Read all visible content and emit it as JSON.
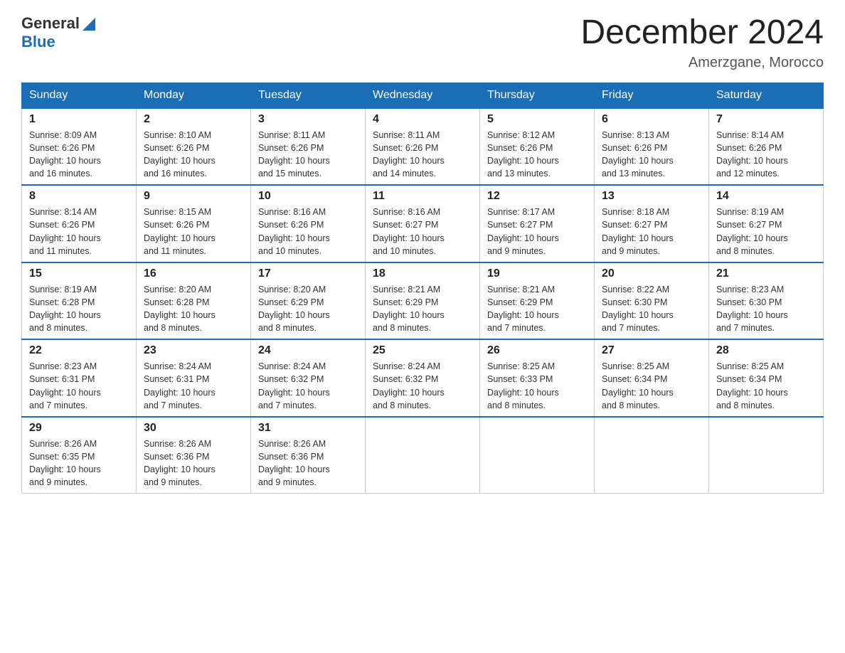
{
  "header": {
    "logo_general": "General",
    "logo_blue": "Blue",
    "month_title": "December 2024",
    "location": "Amerzgane, Morocco"
  },
  "weekdays": [
    "Sunday",
    "Monday",
    "Tuesday",
    "Wednesday",
    "Thursday",
    "Friday",
    "Saturday"
  ],
  "weeks": [
    [
      {
        "day": "1",
        "sunrise": "8:09 AM",
        "sunset": "6:26 PM",
        "daylight": "10 hours and 16 minutes."
      },
      {
        "day": "2",
        "sunrise": "8:10 AM",
        "sunset": "6:26 PM",
        "daylight": "10 hours and 16 minutes."
      },
      {
        "day": "3",
        "sunrise": "8:11 AM",
        "sunset": "6:26 PM",
        "daylight": "10 hours and 15 minutes."
      },
      {
        "day": "4",
        "sunrise": "8:11 AM",
        "sunset": "6:26 PM",
        "daylight": "10 hours and 14 minutes."
      },
      {
        "day": "5",
        "sunrise": "8:12 AM",
        "sunset": "6:26 PM",
        "daylight": "10 hours and 13 minutes."
      },
      {
        "day": "6",
        "sunrise": "8:13 AM",
        "sunset": "6:26 PM",
        "daylight": "10 hours and 13 minutes."
      },
      {
        "day": "7",
        "sunrise": "8:14 AM",
        "sunset": "6:26 PM",
        "daylight": "10 hours and 12 minutes."
      }
    ],
    [
      {
        "day": "8",
        "sunrise": "8:14 AM",
        "sunset": "6:26 PM",
        "daylight": "10 hours and 11 minutes."
      },
      {
        "day": "9",
        "sunrise": "8:15 AM",
        "sunset": "6:26 PM",
        "daylight": "10 hours and 11 minutes."
      },
      {
        "day": "10",
        "sunrise": "8:16 AM",
        "sunset": "6:26 PM",
        "daylight": "10 hours and 10 minutes."
      },
      {
        "day": "11",
        "sunrise": "8:16 AM",
        "sunset": "6:27 PM",
        "daylight": "10 hours and 10 minutes."
      },
      {
        "day": "12",
        "sunrise": "8:17 AM",
        "sunset": "6:27 PM",
        "daylight": "10 hours and 9 minutes."
      },
      {
        "day": "13",
        "sunrise": "8:18 AM",
        "sunset": "6:27 PM",
        "daylight": "10 hours and 9 minutes."
      },
      {
        "day": "14",
        "sunrise": "8:19 AM",
        "sunset": "6:27 PM",
        "daylight": "10 hours and 8 minutes."
      }
    ],
    [
      {
        "day": "15",
        "sunrise": "8:19 AM",
        "sunset": "6:28 PM",
        "daylight": "10 hours and 8 minutes."
      },
      {
        "day": "16",
        "sunrise": "8:20 AM",
        "sunset": "6:28 PM",
        "daylight": "10 hours and 8 minutes."
      },
      {
        "day": "17",
        "sunrise": "8:20 AM",
        "sunset": "6:29 PM",
        "daylight": "10 hours and 8 minutes."
      },
      {
        "day": "18",
        "sunrise": "8:21 AM",
        "sunset": "6:29 PM",
        "daylight": "10 hours and 8 minutes."
      },
      {
        "day": "19",
        "sunrise": "8:21 AM",
        "sunset": "6:29 PM",
        "daylight": "10 hours and 7 minutes."
      },
      {
        "day": "20",
        "sunrise": "8:22 AM",
        "sunset": "6:30 PM",
        "daylight": "10 hours and 7 minutes."
      },
      {
        "day": "21",
        "sunrise": "8:23 AM",
        "sunset": "6:30 PM",
        "daylight": "10 hours and 7 minutes."
      }
    ],
    [
      {
        "day": "22",
        "sunrise": "8:23 AM",
        "sunset": "6:31 PM",
        "daylight": "10 hours and 7 minutes."
      },
      {
        "day": "23",
        "sunrise": "8:24 AM",
        "sunset": "6:31 PM",
        "daylight": "10 hours and 7 minutes."
      },
      {
        "day": "24",
        "sunrise": "8:24 AM",
        "sunset": "6:32 PM",
        "daylight": "10 hours and 7 minutes."
      },
      {
        "day": "25",
        "sunrise": "8:24 AM",
        "sunset": "6:32 PM",
        "daylight": "10 hours and 8 minutes."
      },
      {
        "day": "26",
        "sunrise": "8:25 AM",
        "sunset": "6:33 PM",
        "daylight": "10 hours and 8 minutes."
      },
      {
        "day": "27",
        "sunrise": "8:25 AM",
        "sunset": "6:34 PM",
        "daylight": "10 hours and 8 minutes."
      },
      {
        "day": "28",
        "sunrise": "8:25 AM",
        "sunset": "6:34 PM",
        "daylight": "10 hours and 8 minutes."
      }
    ],
    [
      {
        "day": "29",
        "sunrise": "8:26 AM",
        "sunset": "6:35 PM",
        "daylight": "10 hours and 9 minutes."
      },
      {
        "day": "30",
        "sunrise": "8:26 AM",
        "sunset": "6:36 PM",
        "daylight": "10 hours and 9 minutes."
      },
      {
        "day": "31",
        "sunrise": "8:26 AM",
        "sunset": "6:36 PM",
        "daylight": "10 hours and 9 minutes."
      },
      null,
      null,
      null,
      null
    ]
  ]
}
